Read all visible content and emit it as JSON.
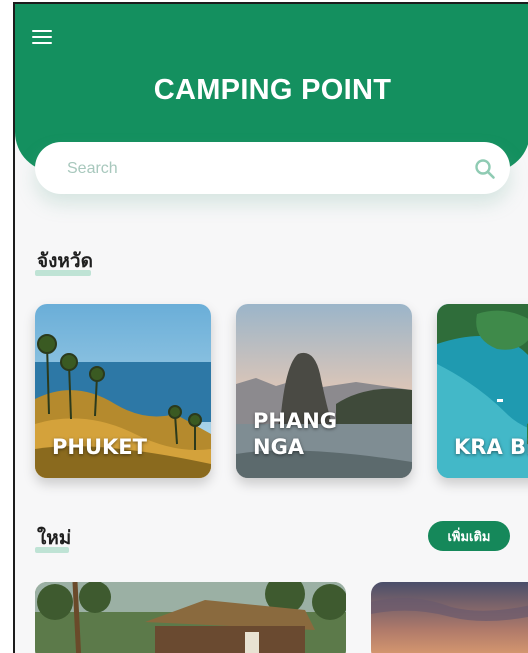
{
  "header": {
    "title": "CAMPING POINT",
    "menu_icon": "hamburger-menu-icon",
    "color": "#14905f"
  },
  "search": {
    "placeholder": "Search",
    "icon": "search-icon"
  },
  "provinces": {
    "title": "จังหวัด",
    "items": [
      {
        "label": "PHUKET"
      },
      {
        "label": "PHANG\nNGA"
      },
      {
        "label": "KRA BI"
      }
    ]
  },
  "new_section": {
    "title": "ใหม่",
    "more_label": "เพิ่มเติม"
  },
  "colors": {
    "accent": "#14905f",
    "underline": "#bfe3d5",
    "background": "#f7f7f8"
  }
}
